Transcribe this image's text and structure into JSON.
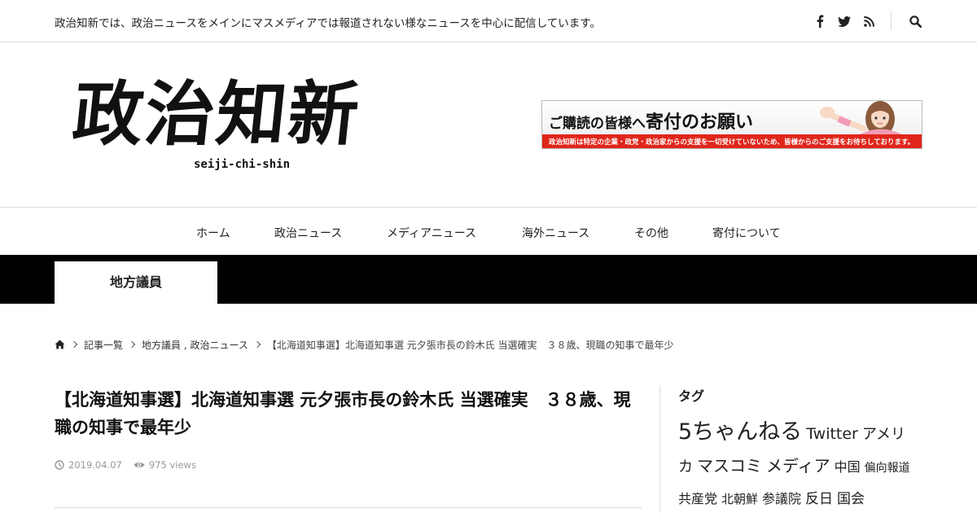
{
  "topbar": {
    "tagline": "政治知新では、政治ニュースをメインにマスメディアでは報道されない様なニュースを中心に配信しています。",
    "social": [
      "facebook-icon",
      "twitter-icon",
      "rss-icon"
    ],
    "search_icon": "search-icon"
  },
  "logo": {
    "title": "政治知新",
    "romaji": "seiji-chi-shin"
  },
  "banner": {
    "title_prefix": "ご購読の皆様へ",
    "title_main": "寄付のお願い",
    "subtitle": "政治知新は特定の企業・政党・政治家からの支援を一切受けていないため、皆様からのご支援をお待ちしております。",
    "accent": "#e0261b"
  },
  "nav": {
    "items": [
      "ホーム",
      "政治ニュース",
      "メディアニュース",
      "海外ニュース",
      "その他",
      "寄付について"
    ]
  },
  "category": {
    "label": "地方議員"
  },
  "breadcrumb": {
    "home_icon": "home-icon",
    "items": [
      "記事一覧",
      "地方議員 , 政治ニュース",
      "【北海道知事選】北海道知事選 元夕張市長の鈴木氏 当選確実　３８歳、現職の知事で最年少"
    ]
  },
  "article": {
    "title": "【北海道知事選】北海道知事選 元夕張市長の鈴木氏 当選確実　３８歳、現職の知事で最年少",
    "date": "2019.04.07",
    "views": "975 views"
  },
  "sidebar": {
    "heading": "タグ",
    "tags": [
      {
        "label": "5ちゃんねる",
        "size": 27
      },
      {
        "label": "Twitter",
        "size": 19
      },
      {
        "label": "アメリカ",
        "size": 18
      },
      {
        "label": "マスコミ",
        "size": 20
      },
      {
        "label": "メディア",
        "size": 20
      },
      {
        "label": "中国",
        "size": 16
      },
      {
        "label": "偏向報道",
        "size": 14
      },
      {
        "label": "共産党",
        "size": 16
      },
      {
        "label": "北朝鮮",
        "size": 15
      },
      {
        "label": "参議院",
        "size": 16
      },
      {
        "label": "反日",
        "size": 17
      },
      {
        "label": "国会",
        "size": 17
      }
    ]
  }
}
